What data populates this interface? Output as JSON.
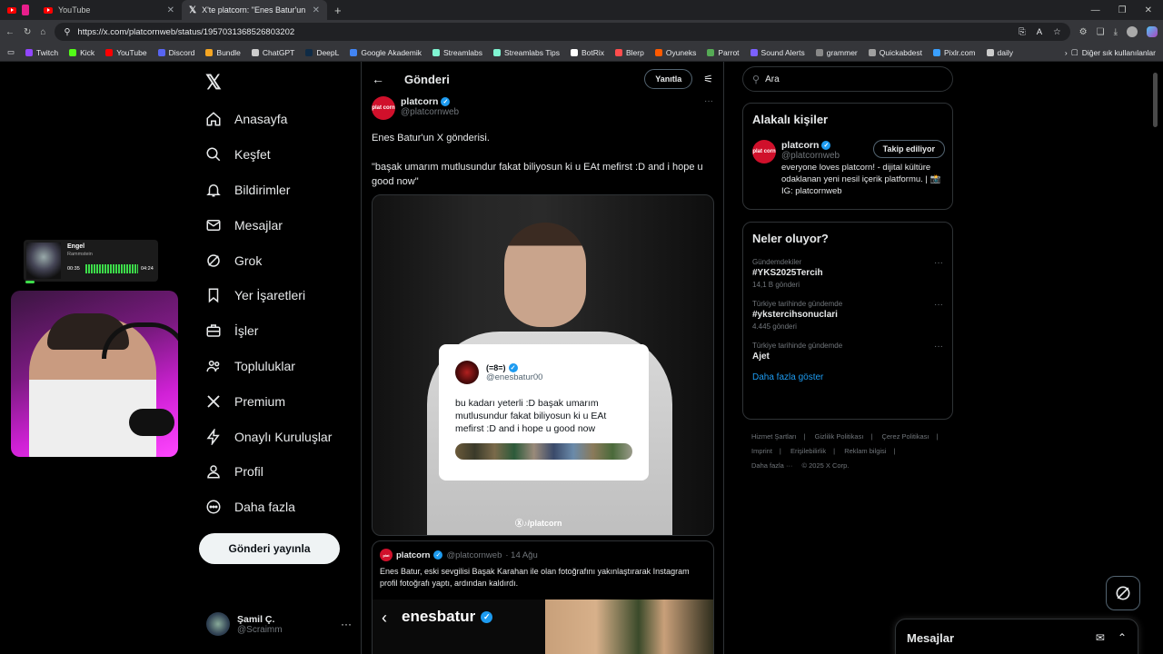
{
  "browser": {
    "tabs": [
      {
        "label": ""
      },
      {
        "label": "YouTube"
      },
      {
        "label": "X'te platcorn: \"Enes Batur'un X gö"
      }
    ],
    "url": "https://x.com/platcornweb/status/1957031368526803202",
    "bookmarks": [
      {
        "label": "Twitch",
        "color": "#9146ff"
      },
      {
        "label": "Kick",
        "color": "#53fc18"
      },
      {
        "label": "YouTube",
        "color": "#ff0000"
      },
      {
        "label": "Discord",
        "color": "#5865f2"
      },
      {
        "label": "Bundle",
        "color": "#f5a623"
      },
      {
        "label": "ChatGPT",
        "color": "#cccccc"
      },
      {
        "label": "DeepL",
        "color": "#0f2b46"
      },
      {
        "label": "Google Akademik",
        "color": "#4285f4"
      },
      {
        "label": "Streamlabs",
        "color": "#80f5d2"
      },
      {
        "label": "Streamlabs Tips",
        "color": "#80f5d2"
      },
      {
        "label": "BotRix",
        "color": "#ffffff"
      },
      {
        "label": "Blerp",
        "color": "#ff4d4d"
      },
      {
        "label": "Oyuneks",
        "color": "#ff5a00"
      },
      {
        "label": "Parrot",
        "color": "#55aa55"
      },
      {
        "label": "Sound Alerts",
        "color": "#7b61ff"
      },
      {
        "label": "grammer",
        "color": "#888888"
      },
      {
        "label": "Quickabdest",
        "color": "#a0a0a0"
      },
      {
        "label": "Pixlr.com",
        "color": "#3aa0ff"
      },
      {
        "label": "daily",
        "color": "#cccccc"
      }
    ],
    "other_bookmarks": "Diğer sık kullanılanlar"
  },
  "overlay": {
    "song_title": "Engel",
    "artist": "Rammstein",
    "time_elapsed": "00:35",
    "time_total": "04:24"
  },
  "nav": {
    "items": [
      {
        "label": "Anasayfa",
        "icon": "home-icon"
      },
      {
        "label": "Keşfet",
        "icon": "search-icon"
      },
      {
        "label": "Bildirimler",
        "icon": "bell-icon"
      },
      {
        "label": "Mesajlar",
        "icon": "mail-icon"
      },
      {
        "label": "Grok",
        "icon": "grok-icon"
      },
      {
        "label": "Yer İşaretleri",
        "icon": "bookmark-icon"
      },
      {
        "label": "İşler",
        "icon": "briefcase-icon"
      },
      {
        "label": "Topluluklar",
        "icon": "people-icon"
      },
      {
        "label": "Premium",
        "icon": "x-icon"
      },
      {
        "label": "Onaylı Kuruluşlar",
        "icon": "lightning-icon"
      },
      {
        "label": "Profil",
        "icon": "user-icon"
      },
      {
        "label": "Daha fazla",
        "icon": "more-circle-icon"
      }
    ],
    "post_button": "Gönderi yayınla",
    "account": {
      "name": "Şamil Ç.",
      "handle": "@Scraimm"
    }
  },
  "post": {
    "header_title": "Gönderi",
    "reply_button": "Yanıtla",
    "author_name": "platcorn",
    "author_handle": "@platcornweb",
    "avatar_text": "plat corn",
    "text_line1": "Enes Batur'un X gönderisi.",
    "text_line2": "\"başak umarım mutlusundur fakat biliyosun ki u EAt mefirst :D  and i hope u good now\"",
    "embedded_card": {
      "name": "(=8=)",
      "handle": "@enesbatur00",
      "text": "bu kadarı yeterli :D başak umarım mutlusundur fakat biliyosun ki u EAt mefirst :D  and i hope u good now"
    },
    "watermark": "Ⓧ♪/platcorn",
    "quoted": {
      "author_name": "platcorn",
      "author_handle": "@platcornweb",
      "date": "· 14 Ağu",
      "text": "Enes Batur, eski sevgilisi Başak Karahan ile olan fotoğrafını yakınlaştırarak Instagram profil fotoğrafı yaptı, ardından kaldırdı.",
      "image_username": "enesbatur"
    }
  },
  "right": {
    "search_placeholder": "Ara",
    "related_title": "Alakalı kişiler",
    "related_user": {
      "name": "platcorn",
      "handle": "@platcornweb",
      "follow_label": "Takip ediliyor",
      "bio": "everyone loves platcorn! - dijital kültüre odaklanan yeni nesil içerik platformu. | 📸 IG: platcornweb"
    },
    "trends_title": "Neler oluyor?",
    "trends": [
      {
        "context": "Gündemdekiler",
        "title": "#YKS2025Tercih",
        "count": "14,1 B gönderi"
      },
      {
        "context": "Türkiye tarihinde gündemde",
        "title": "#ykstercihsonuclari",
        "count": "4.445 gönderi"
      },
      {
        "context": "Türkiye tarihinde gündemde",
        "title": "Ajet",
        "count": ""
      }
    ],
    "show_more": "Daha fazla göster",
    "footer_links": [
      "Hizmet Şartları",
      "|",
      "Gizlilik Politikası",
      "|",
      "Çerez Politikası",
      "|",
      "Imprint",
      "|",
      "Erişilebilirlik",
      "|",
      "Reklam bilgisi",
      "|",
      "Daha fazla ···",
      "© 2025 X Corp."
    ]
  },
  "messages_bar": {
    "title": "Mesajlar"
  },
  "colors": {
    "accent": "#1d9bf0",
    "background": "#000000",
    "border": "#2f3336",
    "muted": "#71767b"
  }
}
